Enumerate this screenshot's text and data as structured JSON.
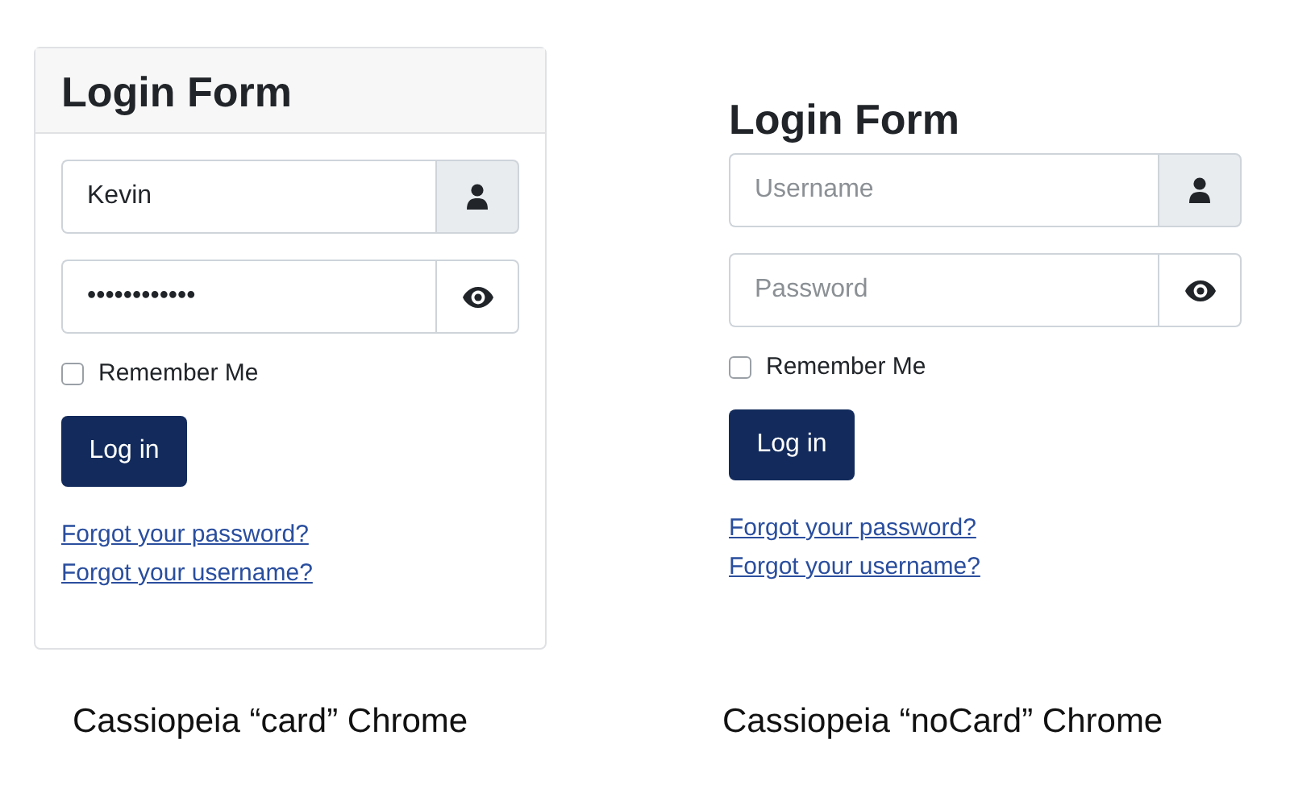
{
  "panels": [
    {
      "kind": "card",
      "title": "Login Form",
      "username": {
        "value": "Kevin"
      },
      "password": {
        "value": "••••••••••••"
      },
      "remember": {
        "label": "Remember Me",
        "checked": false
      },
      "button": "Log in",
      "links": [
        "Forgot your password?",
        "Forgot your username?"
      ],
      "caption": "Cassiopeia “card” Chrome"
    },
    {
      "kind": "nocard",
      "title": "Login Form",
      "username": {
        "placeholder": "Username"
      },
      "password": {
        "placeholder": "Password"
      },
      "remember": {
        "label": "Remember Me",
        "checked": false
      },
      "button": "Log in",
      "links": [
        "Forgot your password?",
        "Forgot your username?"
      ],
      "caption": "Cassiopeia “noCard” Chrome"
    }
  ]
}
